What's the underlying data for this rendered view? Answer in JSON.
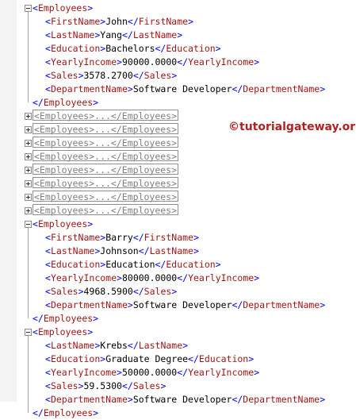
{
  "watermark": "©tutorialgateway.org",
  "lines": [
    {
      "type": "open",
      "toggle": "minus",
      "tag": "Employees"
    },
    {
      "type": "element",
      "tag": "FirstName",
      "value": "John"
    },
    {
      "type": "element",
      "tag": "LastName",
      "value": "Yang"
    },
    {
      "type": "element",
      "tag": "Education",
      "value": "Bachelors"
    },
    {
      "type": "element",
      "tag": "YearlyIncome",
      "value": "90000.0000"
    },
    {
      "type": "element",
      "tag": "Sales",
      "value": "3578.2700"
    },
    {
      "type": "element",
      "tag": "DepartmentName",
      "value": "Software Developer"
    },
    {
      "type": "close",
      "tag": "Employees"
    },
    {
      "type": "collapsed",
      "toggle": "plus",
      "text": "<Employees>...</Employees>"
    },
    {
      "type": "collapsed",
      "toggle": "plus",
      "text": "<Employees>...</Employees>"
    },
    {
      "type": "collapsed",
      "toggle": "plus",
      "text": "<Employees>...</Employees>"
    },
    {
      "type": "collapsed",
      "toggle": "plus",
      "text": "<Employees>...</Employees>"
    },
    {
      "type": "collapsed",
      "toggle": "plus",
      "text": "<Employees>...</Employees>"
    },
    {
      "type": "collapsed",
      "toggle": "plus",
      "text": "<Employees>...</Employees>"
    },
    {
      "type": "collapsed",
      "toggle": "plus",
      "text": "<Employees>...</Employees>"
    },
    {
      "type": "collapsed",
      "toggle": "plus",
      "text": "<Employees>...</Employees>"
    },
    {
      "type": "open",
      "toggle": "minus",
      "tag": "Employees"
    },
    {
      "type": "element",
      "tag": "FirstName",
      "value": "Barry"
    },
    {
      "type": "element",
      "tag": "LastName",
      "value": "Johnson"
    },
    {
      "type": "element",
      "tag": "Education",
      "value": "Education"
    },
    {
      "type": "element",
      "tag": "YearlyIncome",
      "value": "80000.0000"
    },
    {
      "type": "element",
      "tag": "Sales",
      "value": "4968.5900"
    },
    {
      "type": "element",
      "tag": "DepartmentName",
      "value": "Software Developer"
    },
    {
      "type": "close",
      "tag": "Employees"
    },
    {
      "type": "open",
      "toggle": "minus",
      "tag": "Employees"
    },
    {
      "type": "element",
      "tag": "LastName",
      "value": "Krebs"
    },
    {
      "type": "element",
      "tag": "Education",
      "value": "Graduate Degree"
    },
    {
      "type": "element",
      "tag": "YearlyIncome",
      "value": "50000.0000"
    },
    {
      "type": "element",
      "tag": "Sales",
      "value": "59.5300"
    },
    {
      "type": "element",
      "tag": "DepartmentName",
      "value": "Software Developer"
    },
    {
      "type": "close",
      "tag": "Employees"
    }
  ]
}
